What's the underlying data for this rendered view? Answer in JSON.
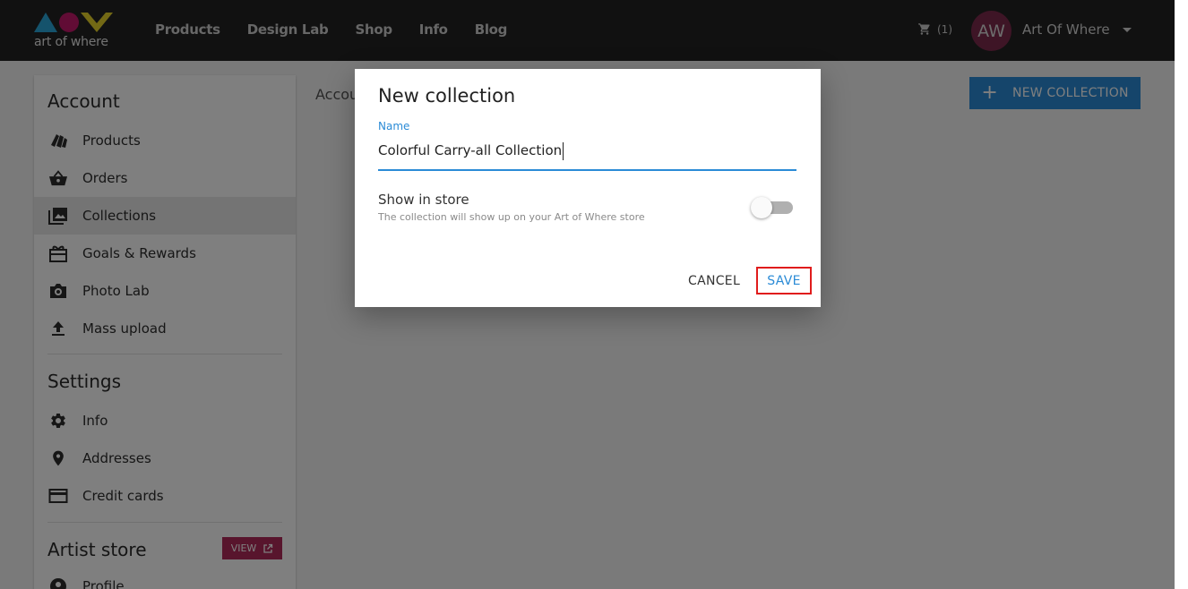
{
  "header": {
    "logo_text": "art of where",
    "nav": [
      "Products",
      "Design Lab",
      "Shop",
      "Info",
      "Blog"
    ],
    "cart_count": "(1)",
    "avatar_initials": "AW",
    "user_name": "Art Of Where"
  },
  "sidebar": {
    "account_title": "Account",
    "account_items": [
      {
        "label": "Products",
        "icon": "products-icon"
      },
      {
        "label": "Orders",
        "icon": "basket-icon"
      },
      {
        "label": "Collections",
        "icon": "collections-icon",
        "active": true
      },
      {
        "label": "Goals & Rewards",
        "icon": "gift-icon"
      },
      {
        "label": "Photo Lab",
        "icon": "camera-icon"
      },
      {
        "label": "Mass upload",
        "icon": "upload-icon"
      }
    ],
    "settings_title": "Settings",
    "settings_items": [
      {
        "label": "Info",
        "icon": "gear-icon"
      },
      {
        "label": "Addresses",
        "icon": "map-pin-icon"
      },
      {
        "label": "Credit cards",
        "icon": "credit-card-icon"
      }
    ],
    "artist_store_title": "Artist store",
    "view_label": "VIEW",
    "artist_store_items": [
      {
        "label": "Profile",
        "icon": "profile-icon"
      }
    ]
  },
  "main": {
    "breadcrumb": "Accou",
    "new_collection_label": "NEW COLLECTION"
  },
  "dialog": {
    "title": "New collection",
    "name_label": "Name",
    "name_value": "Colorful Carry-all Collection",
    "show_in_store_title": "Show in store",
    "show_in_store_help": "The collection will show up on your Art of Where store",
    "show_in_store_enabled": false,
    "cancel_label": "CANCEL",
    "save_label": "SAVE"
  },
  "colors": {
    "accent_blue": "#2b8bd6",
    "brand_pink": "#b12a5b",
    "topbar": "#222222",
    "highlight_red": "#e01c1c"
  }
}
